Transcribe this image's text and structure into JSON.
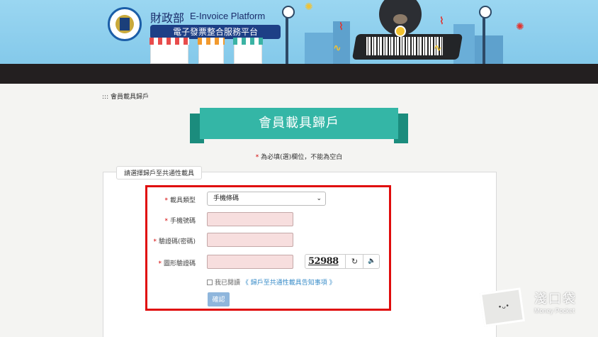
{
  "header": {
    "org_name": "財政部",
    "platform_en": "E-Invoice Platform",
    "platform_cn": "電子發票整合服務平台"
  },
  "breadcrumb": "::: 會員載具歸戶",
  "page_title": "會員載具歸戶",
  "required_note": {
    "star": "*",
    "text": "為必填(選)欄位，不能為空白"
  },
  "form": {
    "legend": "請選擇歸戶至共通性載具",
    "fields": [
      {
        "label": "載具類型",
        "required": "*"
      },
      {
        "label": "手機號碼",
        "required": "*"
      },
      {
        "label": "驗證碼(密碼)",
        "required": "*"
      },
      {
        "label": "圖形驗證碼",
        "required": "*"
      }
    ],
    "carrier_type_selected": "手機條碼",
    "captcha_text": "52988",
    "agree_text": "我已閱讀",
    "agree_link": "《 歸戶至共通性載具告知事項 》",
    "confirm_label": "確認"
  },
  "watermark": {
    "name_cn": "淺口袋",
    "name_en": "Money Pocket"
  },
  "colors": {
    "banner_bg": "#8fd0ee",
    "nav_bar": "#231f20",
    "title_teal": "#34b6a6",
    "highlight_red": "#e00c0c",
    "input_bg": "#f7dede",
    "button_blue": "#8fb6dc"
  },
  "icons": {
    "refresh": "refresh-icon",
    "audio": "speaker-icon",
    "dropdown": "chevron-down-icon"
  }
}
